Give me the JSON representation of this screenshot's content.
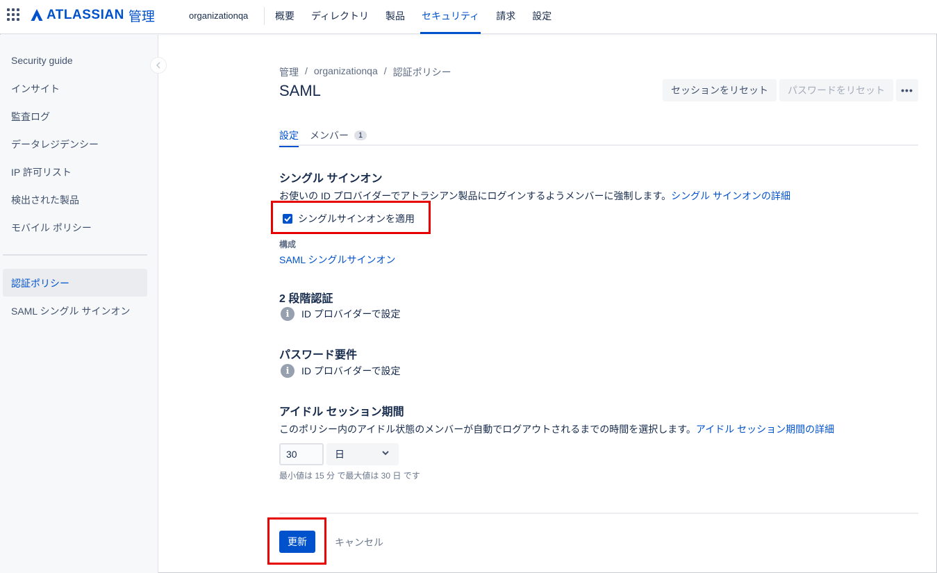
{
  "header": {
    "logo_text": "ATLASSIAN",
    "logo_suffix": "管理",
    "org_name": "organizationqa",
    "nav": [
      "概要",
      "ディレクトリ",
      "製品",
      "セキュリティ",
      "請求",
      "設定"
    ],
    "active_nav": "セキュリティ"
  },
  "sidebar": {
    "items": [
      {
        "label": "Security guide"
      },
      {
        "label": "インサイト"
      },
      {
        "label": "監査ログ"
      },
      {
        "label": "データレジデンシー"
      },
      {
        "label": "IP 許可リスト"
      },
      {
        "label": "検出された製品"
      },
      {
        "label": "モバイル ポリシー"
      },
      {
        "label": "認証ポリシー"
      },
      {
        "label": "SAML シングル サインオン"
      }
    ],
    "active": "認証ポリシー"
  },
  "breadcrumb": [
    "管理",
    "organizationqa",
    "認証ポリシー"
  ],
  "page_title": "SAML",
  "actions": {
    "reset_sessions": "セッションをリセット",
    "reset_passwords": "パスワードをリセット",
    "more": "•••"
  },
  "tabs": {
    "settings": "設定",
    "members": "メンバー",
    "members_count": "1"
  },
  "sso": {
    "title": "シングル サインオン",
    "description": "お使いの ID プロバイダーでアトラシアン製品にログインするようメンバーに強制します。",
    "learn_more": "シングル サインオンの詳細",
    "enforce_label": "シングルサインオンを適用",
    "enforce_checked": true,
    "config_label": "構成",
    "config_link": "SAML シングルサインオン"
  },
  "two_step": {
    "title": "2 段階認証",
    "info": "ID プロバイダーで設定"
  },
  "password": {
    "title": "パスワード要件",
    "info": "ID プロバイダーで設定"
  },
  "idle": {
    "title": "アイドル セッション期間",
    "description": "このポリシー内のアイドル状態のメンバーが自動でログアウトされるまでの時間を選択します。",
    "learn_more": "アイドル セッション期間の詳細",
    "value": "30",
    "unit": "日",
    "hint": "最小値は 15 分 で最大値は 30 日 です"
  },
  "footer": {
    "update": "更新",
    "cancel": "キャンセル"
  },
  "colors": {
    "brand": "#0052cc",
    "highlight": "#e60000"
  }
}
